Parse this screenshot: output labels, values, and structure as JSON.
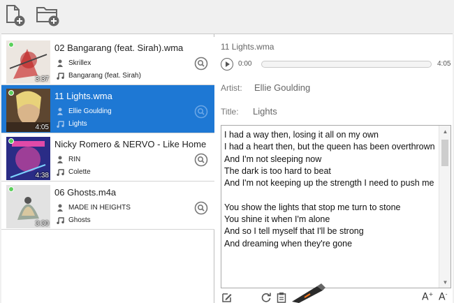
{
  "toolbar": {
    "buttons": [
      {
        "name": "add-file",
        "icon": "file-plus-icon"
      },
      {
        "name": "add-folder",
        "icon": "folder-plus-icon"
      }
    ]
  },
  "tracks": [
    {
      "title": "02 Bangarang (feat. Sirah).wma",
      "artist": "Skrillex",
      "song": "Bangarang (feat. Sirah)",
      "duration": "3:37",
      "selected": false,
      "thumb_color": "#e8e0d8"
    },
    {
      "title": "11 Lights.wma",
      "artist": "Ellie Goulding",
      "song": "Lights",
      "duration": "4:05",
      "selected": true,
      "thumb_color": "#6e5238"
    },
    {
      "title": "Nicky Romero & NERVO - Like Home",
      "artist": "RIN",
      "song": "Colette",
      "duration": "4:38",
      "selected": false,
      "thumb_color": "#2d2f8c"
    },
    {
      "title": "06 Ghosts.m4a",
      "artist": "MADE IN HEIGHTS",
      "song": "Ghosts",
      "duration": "3:30",
      "selected": false,
      "thumb_color": "#dedede"
    }
  ],
  "detail": {
    "filename": "11 Lights.wma",
    "time_start": "0:00",
    "time_end": "4:05",
    "progress": 0.0,
    "artist_label": "Artist:",
    "artist_value": "Ellie Goulding",
    "title_label": "Title:",
    "title_value": "Lights",
    "lyrics": "I had a way then, losing it all on my own\nI had a heart then, but the queen has been overthrown\nAnd I'm not sleeping now\nThe dark is too hard to beat\nAnd I'm not keeping up the strength I need to push me\n\nYou show the lights that stop me turn to stone\nYou shine it when I'm alone\nAnd so I tell myself that I'll be strong\nAnd dreaming when they're gone"
  },
  "bottom": {
    "font_increase": "A",
    "font_decrease": "A",
    "font_increase_mark": "+",
    "font_decrease_mark": "-"
  },
  "colors": {
    "selection": "#1e78d4",
    "status_dot": "#5bd05b"
  }
}
